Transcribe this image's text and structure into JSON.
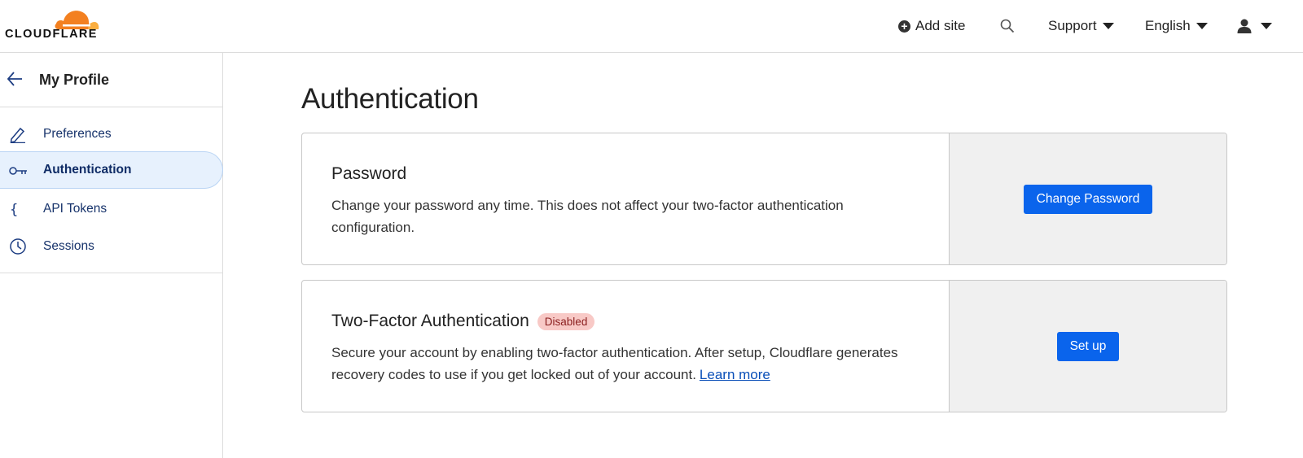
{
  "brand": {
    "name": "CLOUDFLARE",
    "orange": "#f38020",
    "light_orange": "#faae40"
  },
  "header": {
    "add_site_label": "Add site",
    "support_label": "Support",
    "language_label": "English"
  },
  "sidebar": {
    "back_title": "My Profile",
    "items": [
      {
        "label": "Preferences",
        "icon": "pencil-icon"
      },
      {
        "label": "Authentication",
        "icon": "key-icon",
        "active": true
      },
      {
        "label": "API Tokens",
        "icon": "braces-icon"
      },
      {
        "label": "Sessions",
        "icon": "clock-icon"
      }
    ]
  },
  "main": {
    "title": "Authentication",
    "password_card": {
      "title": "Password",
      "description": "Change your password any time. This does not affect your two-factor authentication configuration.",
      "button_label": "Change Password"
    },
    "twofa_card": {
      "title": "Two-Factor Authentication",
      "status_badge": "Disabled",
      "description": "Secure your account by enabling two-factor authentication. After setup, Cloudflare generates recovery codes to use if you get locked out of your account.",
      "learn_more_label": "Learn more",
      "button_label": "Set up"
    }
  },
  "colors": {
    "accent": "#0a64ec",
    "active_bg": "#e7f1fd",
    "badge_bg": "#f8c9c6"
  }
}
